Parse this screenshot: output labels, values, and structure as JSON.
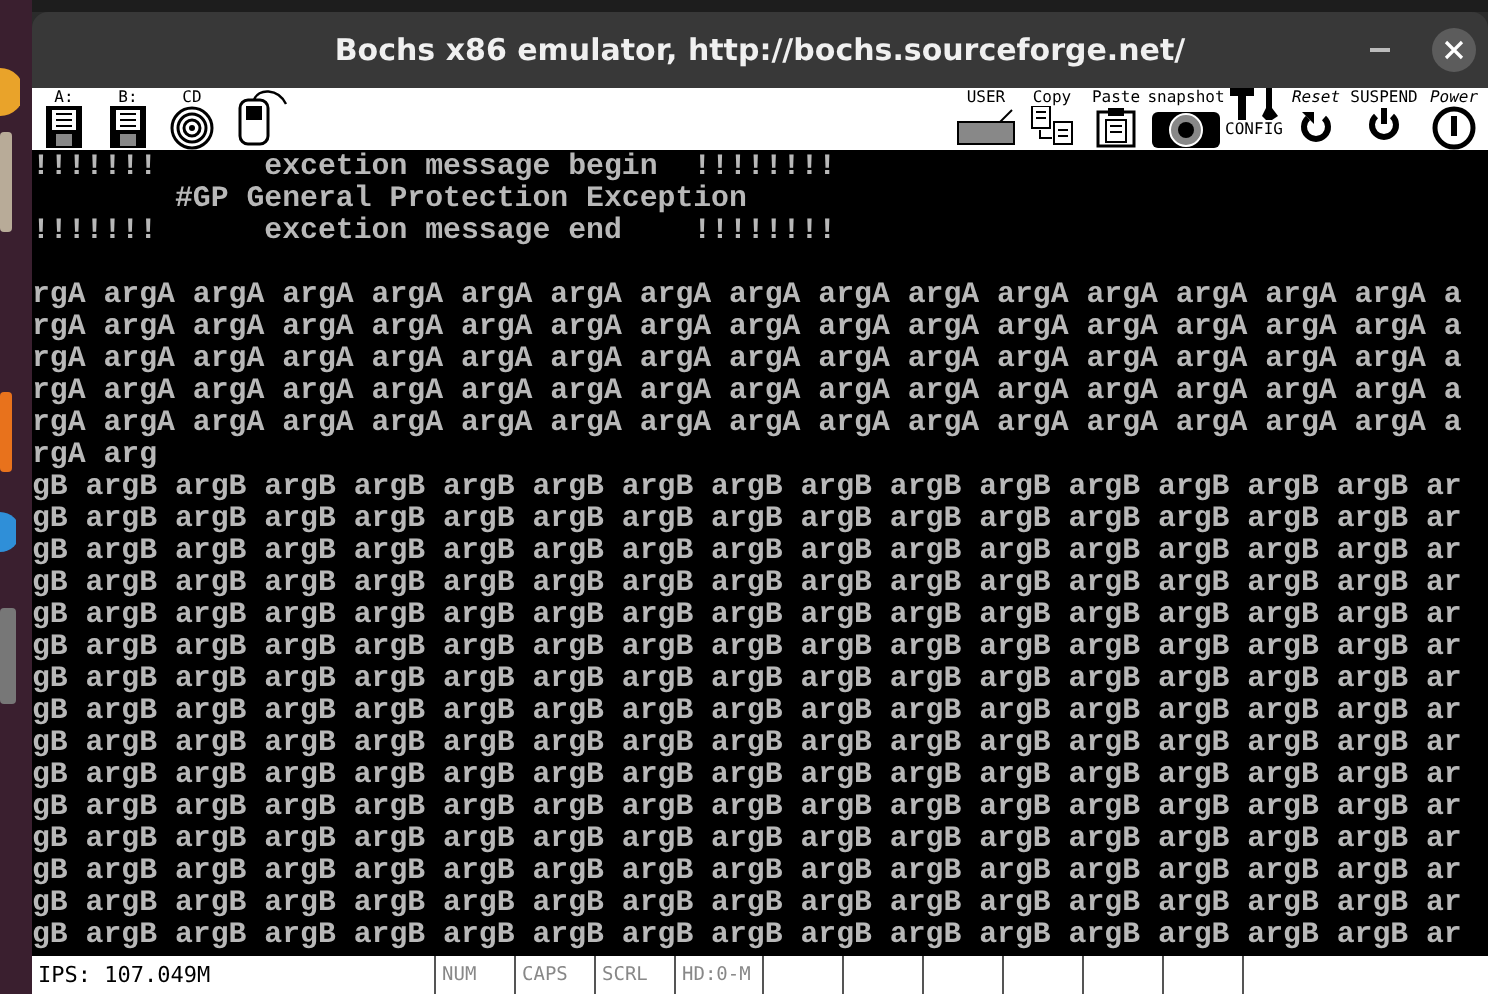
{
  "window": {
    "title": "Bochs x86 emulator, http://bochs.sourceforge.net/"
  },
  "toolbar": {
    "left": [
      {
        "kind": "floppy",
        "label": "A:"
      },
      {
        "kind": "floppy",
        "label": "B:"
      },
      {
        "kind": "cdrom",
        "label": "CD"
      },
      {
        "kind": "mouse"
      }
    ],
    "right": [
      {
        "kind": "keyboard",
        "label": "USER"
      },
      {
        "kind": "copy",
        "label": "Copy"
      },
      {
        "kind": "paste",
        "label": "Paste"
      },
      {
        "kind": "snapshot",
        "label": "snapshot"
      },
      {
        "kind": "config",
        "label": "CONFIG"
      },
      {
        "kind": "reset",
        "label": "Reset"
      },
      {
        "kind": "suspend",
        "label": "SUSPEND"
      },
      {
        "kind": "power",
        "label": "Power"
      }
    ]
  },
  "console": {
    "header_lines": [
      "!!!!!!!      excetion message begin  !!!!!!!!",
      "        #GP General Protection Exception",
      "!!!!!!!      excetion message end    !!!!!!!!"
    ],
    "body_lines": [
      "rgA argA argA argA argA argA argA argA argA argA argA argA argA argA argA argA a",
      "rgA argA argA argA argA argA argA argA argA argA argA argA argA argA argA argA a",
      "rgA argA argA argA argA argA argA argA argA argA argA argA argA argA argA argA a",
      "rgA argA argA argA argA argA argA argA argA argA argA argA argA argA argA argA a",
      "rgA argA argA argA argA argA argA argA argA argA argA argA argA argA argA argA a",
      "rgA arg",
      "gB argB argB argB argB argB argB argB argB argB argB argB argB argB argB argB ar",
      "gB argB argB argB argB argB argB argB argB argB argB argB argB argB argB argB ar",
      "gB argB argB argB argB argB argB argB argB argB argB argB argB argB argB argB ar",
      "gB argB argB argB argB argB argB argB argB argB argB argB argB argB argB argB ar",
      "gB argB argB argB argB argB argB argB argB argB argB argB argB argB argB argB ar",
      "gB argB argB argB argB argB argB argB argB argB argB argB argB argB argB argB ar",
      "gB argB argB argB argB argB argB argB argB argB argB argB argB argB argB argB ar",
      "gB argB argB argB argB argB argB argB argB argB argB argB argB argB argB argB ar",
      "gB argB argB argB argB argB argB argB argB argB argB argB argB argB argB argB ar",
      "gB argB argB argB argB argB argB argB argB argB argB argB argB argB argB argB ar",
      "gB argB argB argB argB argB argB argB argB argB argB argB argB argB argB argB ar",
      "gB argB argB argB argB argB argB argB argB argB argB argB argB argB argB argB ar",
      "gB argB argB argB argB argB argB argB argB argB argB argB argB argB argB argB ar",
      "gB argB argB argB argB argB argB argB argB argB argB argB argB argB argB argB ar",
      "gB argB argB argB argB argB argB argB argB argB argB argB argB argB argB argB ar"
    ]
  },
  "status_bar": {
    "ips": "IPS: 107.049M",
    "indicators": [
      {
        "label": "NUM",
        "on": false
      },
      {
        "label": "CAPS",
        "on": false
      },
      {
        "label": "SCRL",
        "on": false
      },
      {
        "label": "HD:0-M",
        "on": false
      }
    ]
  }
}
